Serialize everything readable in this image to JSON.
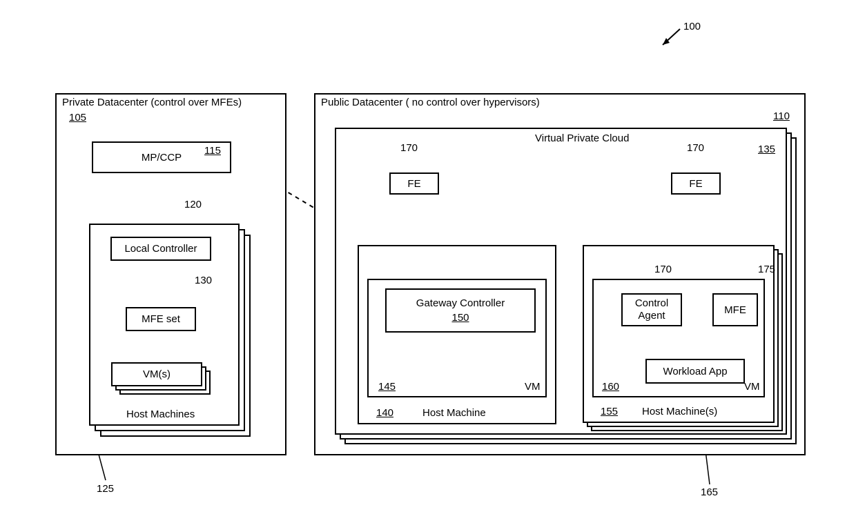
{
  "figure_ref": "100",
  "private_dc": {
    "title": "Private Datacenter (control over MFEs)",
    "ref": "105",
    "mpccp": {
      "label": "MP/CCP",
      "ref": "115"
    },
    "local_controller": {
      "label": "Local Controller",
      "ref": "120"
    },
    "mfe_set": {
      "label": "MFE set",
      "ref": "130"
    },
    "vms": {
      "label": "VM(s)"
    },
    "host_machines": {
      "label": "Host Machines",
      "ref": "125"
    }
  },
  "public_dc": {
    "title": "Public Datacenter ( no control over hypervisors)",
    "ref": "110",
    "vpc": {
      "title": "Virtual Private Cloud",
      "ref": "135"
    },
    "fe1": {
      "label": "FE",
      "ref": "170"
    },
    "fe2": {
      "label": "FE",
      "ref": "170"
    },
    "host1": {
      "ref": "140",
      "label": "Host Machine",
      "vm": {
        "ref": "145",
        "label": "VM"
      },
      "gateway": {
        "label": "Gateway Controller",
        "ref": "150"
      }
    },
    "host2": {
      "ref": "155",
      "label": "Host Machine(s)",
      "vm": {
        "ref": "160",
        "label": "VM"
      },
      "control_agent": {
        "label": "Control Agent",
        "ref": "170"
      },
      "mfe": {
        "label": "MFE",
        "ref": "175"
      },
      "workload": {
        "label": "Workload App",
        "ref": "165"
      }
    }
  }
}
